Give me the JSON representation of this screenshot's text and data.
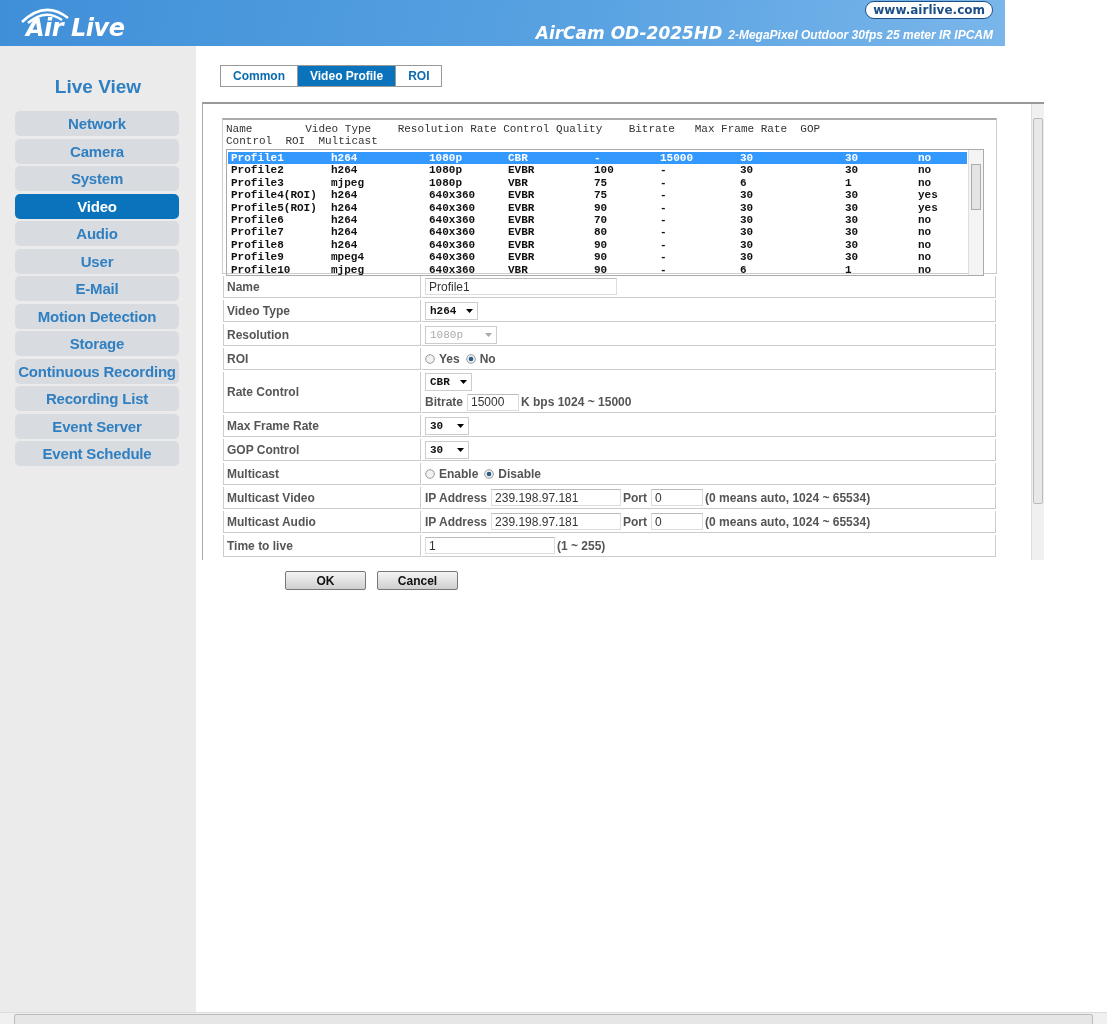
{
  "header": {
    "brand": "Air Live",
    "website": "www.airlive.com",
    "model": "AirCam OD-2025HD",
    "tagline": "2-MegaPixel Outdoor 30fps 25 meter IR IPCAM"
  },
  "sidebar": {
    "title": "Live View",
    "items": [
      {
        "label": "Network",
        "selected": false
      },
      {
        "label": "Camera",
        "selected": false
      },
      {
        "label": "System",
        "selected": false
      },
      {
        "label": "Video",
        "selected": true
      },
      {
        "label": "Audio",
        "selected": false
      },
      {
        "label": "User",
        "selected": false
      },
      {
        "label": "E-Mail",
        "selected": false
      },
      {
        "label": "Motion Detection",
        "selected": false
      },
      {
        "label": "Storage",
        "selected": false
      },
      {
        "label": "Continuous Recording",
        "selected": false
      },
      {
        "label": "Recording List",
        "selected": false
      },
      {
        "label": "Event Server",
        "selected": false
      },
      {
        "label": "Event Schedule",
        "selected": false
      }
    ]
  },
  "tabs": [
    {
      "label": "Common",
      "selected": false
    },
    {
      "label": "Video Profile",
      "selected": true
    },
    {
      "label": "ROI",
      "selected": false
    }
  ],
  "profile_list": {
    "header_lines": [
      "Name        Video Type    Resolution Rate Control Quality    Bitrate   Max Frame Rate  GOP",
      "Control  ROI  Multicast"
    ],
    "rows": [
      {
        "cells": [
          "Profile1",
          "h264",
          "1080p",
          "CBR",
          "-",
          "15000",
          "30",
          "30",
          "no"
        ],
        "selected": true
      },
      {
        "cells": [
          "Profile2",
          "h264",
          "1080p",
          "EVBR",
          "100",
          "-",
          "30",
          "30",
          "no"
        ],
        "selected": false
      },
      {
        "cells": [
          "Profile3",
          "mjpeg",
          "1080p",
          "VBR",
          "75",
          "-",
          "6",
          "1",
          "no"
        ],
        "selected": false
      },
      {
        "cells": [
          "Profile4(ROI)",
          "h264",
          "640x360",
          "EVBR",
          "75",
          "-",
          "30",
          "30",
          "yes"
        ],
        "selected": false
      },
      {
        "cells": [
          "Profile5(ROI)",
          "h264",
          "640x360",
          "EVBR",
          "90",
          "-",
          "30",
          "30",
          "yes"
        ],
        "selected": false
      },
      {
        "cells": [
          "Profile6",
          "h264",
          "640x360",
          "EVBR",
          "70",
          "-",
          "30",
          "30",
          "no"
        ],
        "selected": false
      },
      {
        "cells": [
          "Profile7",
          "h264",
          "640x360",
          "EVBR",
          "80",
          "-",
          "30",
          "30",
          "no"
        ],
        "selected": false
      },
      {
        "cells": [
          "Profile8",
          "h264",
          "640x360",
          "EVBR",
          "90",
          "-",
          "30",
          "30",
          "no"
        ],
        "selected": false
      },
      {
        "cells": [
          "Profile9",
          "mpeg4",
          "640x360",
          "EVBR",
          "90",
          "-",
          "30",
          "30",
          "no"
        ],
        "selected": false
      },
      {
        "cells": [
          "Profile10",
          "mjpeg",
          "640x360",
          "VBR",
          "90",
          "-",
          "6",
          "1",
          "no"
        ],
        "selected": false
      }
    ]
  },
  "form": [
    {
      "label": "Name",
      "lines": [
        [
          {
            "kind": "wide-input",
            "value": "Profile1"
          }
        ]
      ]
    },
    {
      "label": "Video Type",
      "lines": [
        [
          {
            "kind": "select",
            "value": "h264",
            "disabled": false
          }
        ]
      ]
    },
    {
      "label": "Resolution",
      "lines": [
        [
          {
            "kind": "select",
            "value": "1080p",
            "disabled": true
          }
        ]
      ]
    },
    {
      "label": "ROI",
      "lines": [
        [
          {
            "kind": "radio",
            "label": "Yes",
            "selected": false
          },
          {
            "kind": "radio",
            "label": "No",
            "selected": true
          }
        ]
      ]
    },
    {
      "label": "Rate Control",
      "lines": [
        [
          {
            "kind": "select",
            "value": "CBR",
            "disabled": false
          }
        ],
        [
          {
            "kind": "text",
            "text": "Bitrate"
          },
          {
            "kind": "short-input",
            "value": "15000"
          },
          {
            "kind": "text",
            "text": "K bps 1024 ~ 15000"
          }
        ]
      ]
    },
    {
      "label": "Max Frame Rate",
      "lines": [
        [
          {
            "kind": "select",
            "value": "30",
            "disabled": false
          }
        ]
      ]
    },
    {
      "label": "GOP Control",
      "lines": [
        [
          {
            "kind": "select",
            "value": "30",
            "disabled": false
          }
        ]
      ]
    },
    {
      "label": "Multicast",
      "lines": [
        [
          {
            "kind": "radio",
            "label": "Enable",
            "selected": false
          },
          {
            "kind": "radio",
            "label": "Disable",
            "selected": true
          }
        ]
      ]
    },
    {
      "label": "Multicast Video",
      "lines": [
        [
          {
            "kind": "text",
            "text": "IP Address"
          },
          {
            "kind": "input",
            "value": "239.198.97.181"
          },
          {
            "kind": "text",
            "text": "Port"
          },
          {
            "kind": "short-input",
            "value": "0"
          },
          {
            "kind": "text",
            "text": "(0 means auto, 1024 ~ 65534)"
          }
        ]
      ]
    },
    {
      "label": "Multicast Audio",
      "lines": [
        [
          {
            "kind": "text",
            "text": "IP Address"
          },
          {
            "kind": "input",
            "value": "239.198.97.181"
          },
          {
            "kind": "text",
            "text": "Port"
          },
          {
            "kind": "short-input",
            "value": "0"
          },
          {
            "kind": "text",
            "text": "(0 means auto, 1024 ~ 65534)"
          }
        ]
      ]
    },
    {
      "label": "Time to live",
      "lines": [
        [
          {
            "kind": "input",
            "value": "1"
          },
          {
            "kind": "text",
            "text": "(1 ~ 255)"
          }
        ]
      ]
    }
  ],
  "buttons": [
    "OK",
    "Cancel"
  ]
}
